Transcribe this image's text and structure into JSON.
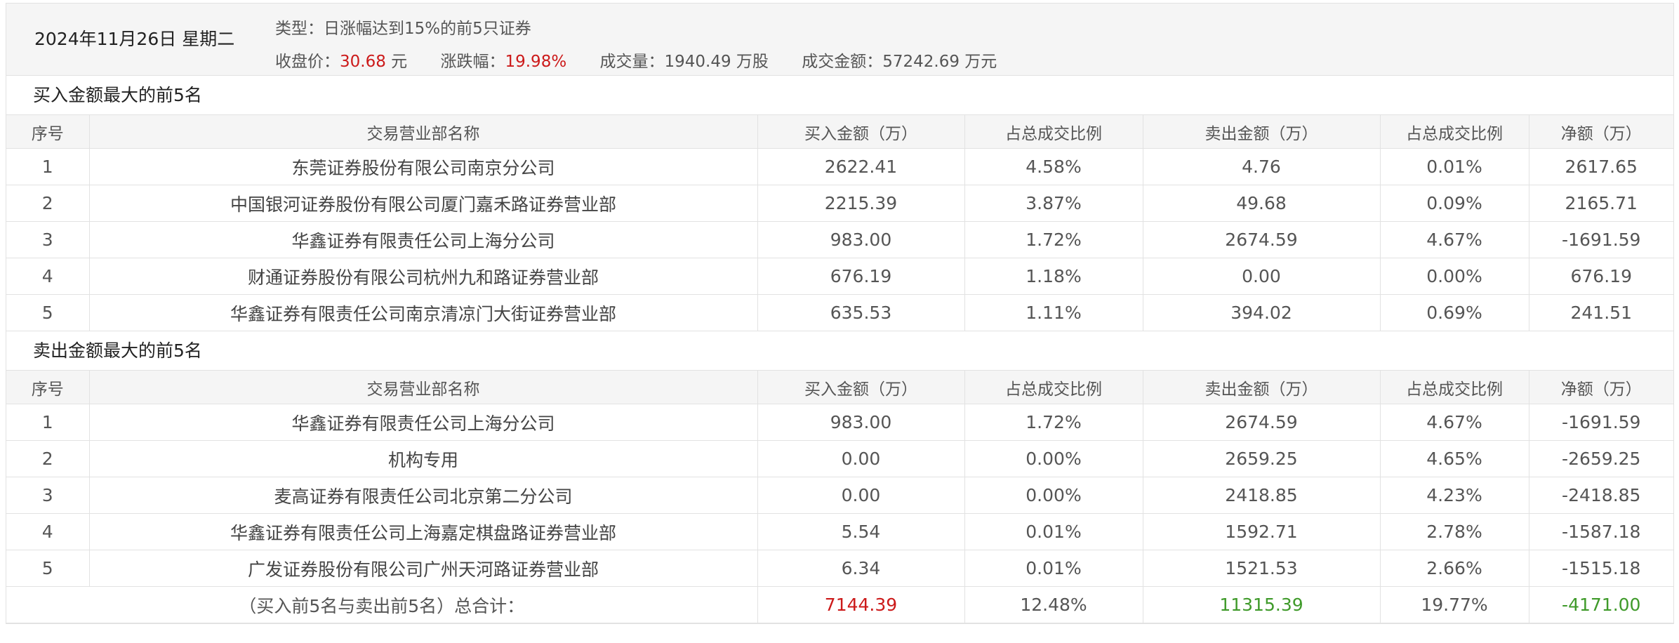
{
  "header": {
    "date": "2024年11月26日 星期二",
    "type_label": "类型：",
    "type_value": "日涨幅达到15%的前5只证券",
    "close_label": "收盘价：",
    "close_value": "30.68",
    "close_unit": "元",
    "change_label": "涨跌幅：",
    "change_value": "19.98%",
    "volume_label": "成交量：",
    "volume_value": "1940.49 万股",
    "amount_label": "成交金额：",
    "amount_value": "57242.69 万元"
  },
  "columns": [
    "序号",
    "交易营业部名称",
    "买入金额（万）",
    "占总成交比例",
    "卖出金额（万）",
    "占总成交比例",
    "净额（万）"
  ],
  "buy_section": {
    "title": "买入金额最大的前5名",
    "rows": [
      {
        "idx": "1",
        "name": "东莞证券股份有限公司南京分公司",
        "buy": "2622.41",
        "buy_pct": "4.58%",
        "sell": "4.76",
        "sell_pct": "0.01%",
        "net": "2617.65"
      },
      {
        "idx": "2",
        "name": "中国银河证券股份有限公司厦门嘉禾路证券营业部",
        "buy": "2215.39",
        "buy_pct": "3.87%",
        "sell": "49.68",
        "sell_pct": "0.09%",
        "net": "2165.71"
      },
      {
        "idx": "3",
        "name": "华鑫证券有限责任公司上海分公司",
        "buy": "983.00",
        "buy_pct": "1.72%",
        "sell": "2674.59",
        "sell_pct": "4.67%",
        "net": "-1691.59"
      },
      {
        "idx": "4",
        "name": "财通证券股份有限公司杭州九和路证券营业部",
        "buy": "676.19",
        "buy_pct": "1.18%",
        "sell": "0.00",
        "sell_pct": "0.00%",
        "net": "676.19"
      },
      {
        "idx": "5",
        "name": "华鑫证券有限责任公司南京清凉门大街证券营业部",
        "buy": "635.53",
        "buy_pct": "1.11%",
        "sell": "394.02",
        "sell_pct": "0.69%",
        "net": "241.51"
      }
    ]
  },
  "sell_section": {
    "title": "卖出金额最大的前5名",
    "rows": [
      {
        "idx": "1",
        "name": "华鑫证券有限责任公司上海分公司",
        "buy": "983.00",
        "buy_pct": "1.72%",
        "sell": "2674.59",
        "sell_pct": "4.67%",
        "net": "-1691.59"
      },
      {
        "idx": "2",
        "name": "机构专用",
        "buy": "0.00",
        "buy_pct": "0.00%",
        "sell": "2659.25",
        "sell_pct": "4.65%",
        "net": "-2659.25"
      },
      {
        "idx": "3",
        "name": "麦高证券有限责任公司北京第二分公司",
        "buy": "0.00",
        "buy_pct": "0.00%",
        "sell": "2418.85",
        "sell_pct": "4.23%",
        "net": "-2418.85"
      },
      {
        "idx": "4",
        "name": "华鑫证券有限责任公司上海嘉定棋盘路证券营业部",
        "buy": "5.54",
        "buy_pct": "0.01%",
        "sell": "1592.71",
        "sell_pct": "2.78%",
        "net": "-1587.18"
      },
      {
        "idx": "5",
        "name": "广发证券股份有限公司广州天河路证券营业部",
        "buy": "6.34",
        "buy_pct": "0.01%",
        "sell": "1521.53",
        "sell_pct": "2.66%",
        "net": "-1515.18"
      }
    ]
  },
  "total": {
    "label": "（买入前5名与卖出前5名）总合计：",
    "buy": "7144.39",
    "buy_pct": "12.48%",
    "sell": "11315.39",
    "sell_pct": "19.77%",
    "net": "-4171.00"
  },
  "colors": {
    "positive": "#cc1a1a",
    "negative": "#3f9a2a",
    "header_bg": "#f5f5f5",
    "border": "#e2e2e2"
  }
}
